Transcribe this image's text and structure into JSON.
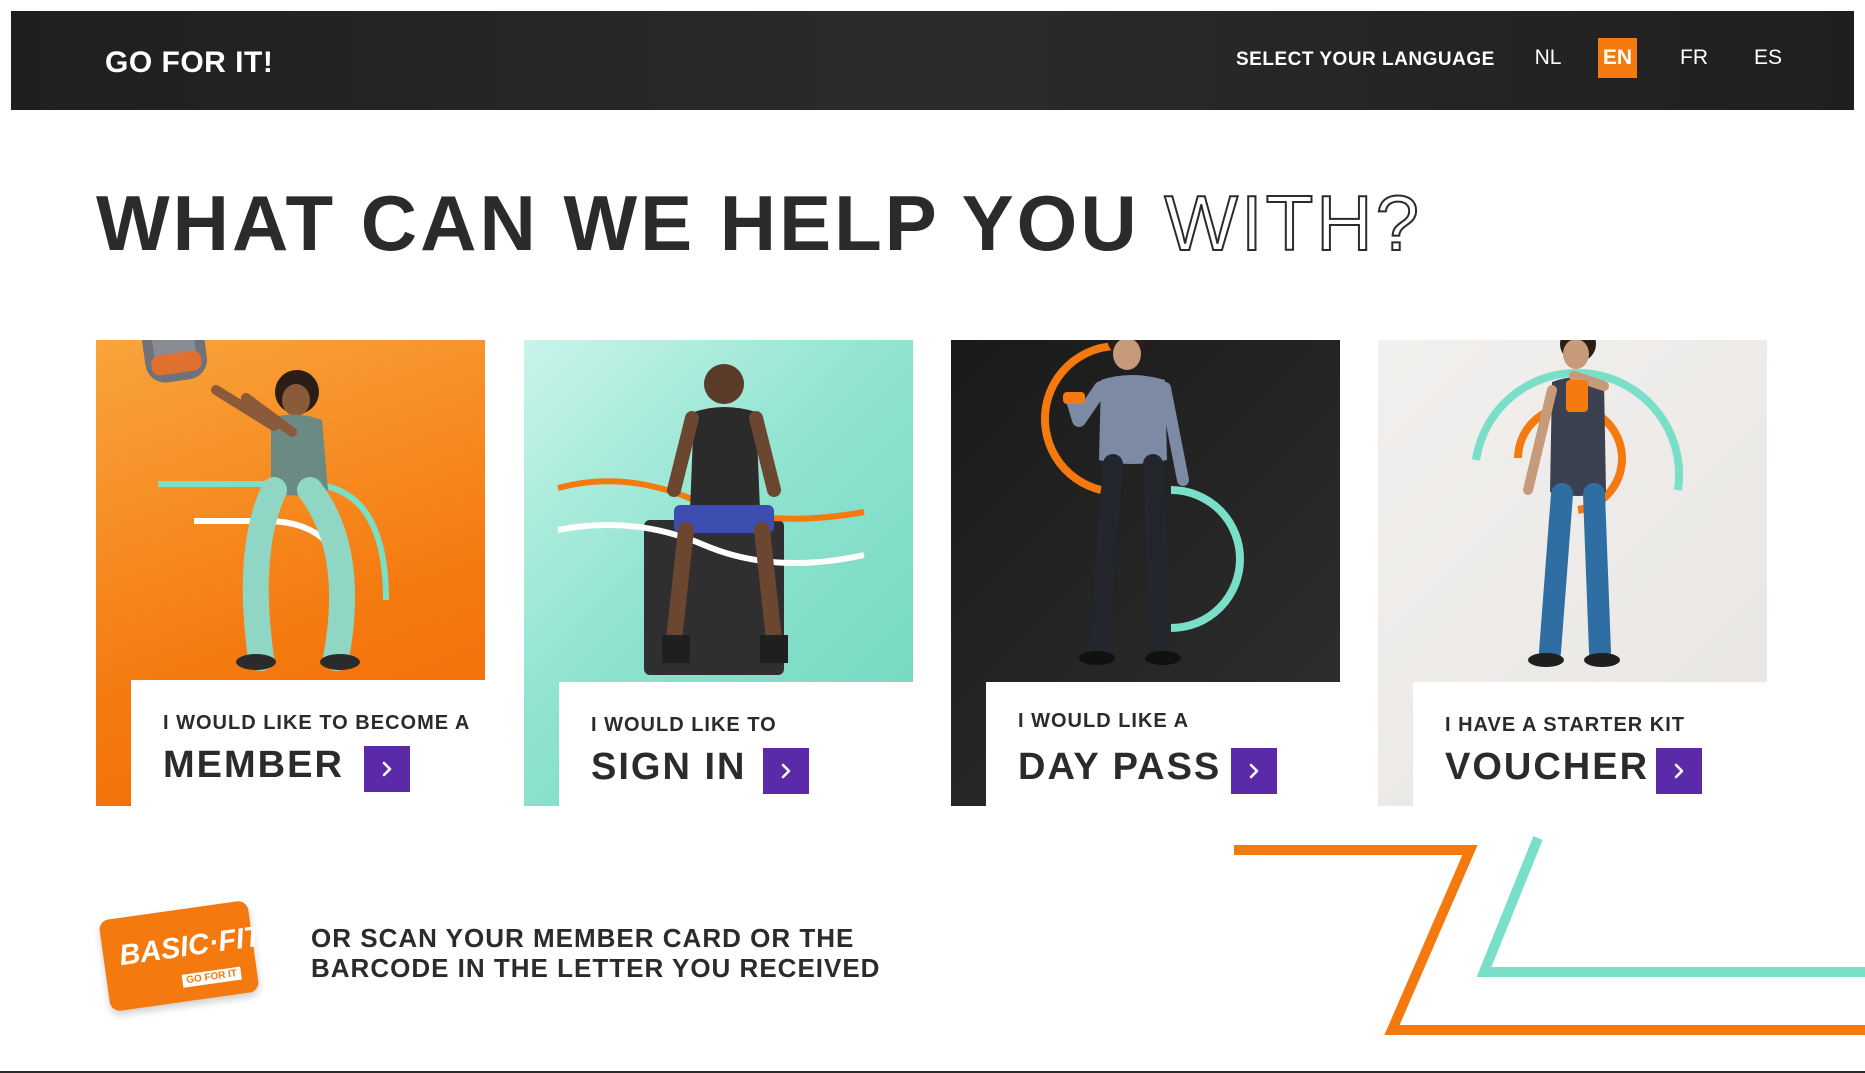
{
  "header": {
    "brand": "GO FOR IT!",
    "language_label": "SELECT YOUR LANGUAGE",
    "languages": [
      {
        "code": "NL",
        "active": false
      },
      {
        "code": "EN",
        "active": true
      },
      {
        "code": "FR",
        "active": false
      },
      {
        "code": "ES",
        "active": false
      }
    ]
  },
  "main": {
    "title_solid": "WHAT CAN WE HELP YOU",
    "title_outline": "WITH?"
  },
  "cards": [
    {
      "small": "I WOULD LIKE TO BECOME A",
      "big": "MEMBER",
      "theme": "#f47a0f",
      "icon": "chevron-right-icon"
    },
    {
      "small": "I WOULD LIKE TO",
      "big": "SIGN IN",
      "theme": "#7adfc8",
      "icon": "chevron-right-icon"
    },
    {
      "small": "I WOULD LIKE A",
      "big": "DAY PASS",
      "theme": "#1f1f1f",
      "icon": "chevron-right-icon"
    },
    {
      "small": "I HAVE A STARTER KIT",
      "big": "VOUCHER",
      "theme": "#efedeb",
      "icon": "chevron-right-icon"
    }
  ],
  "scan": {
    "card_brand": "BASIC·FIT",
    "card_tagline": "GO FOR IT",
    "line1": "OR SCAN YOUR MEMBER CARD OR THE",
    "line2": "BARCODE IN THE LETTER YOU RECEIVED"
  },
  "colors": {
    "accent_orange": "#f47a0f",
    "accent_mint": "#7adfc8",
    "accent_purple": "#5b2aa8",
    "dark": "#2b2b2b"
  }
}
